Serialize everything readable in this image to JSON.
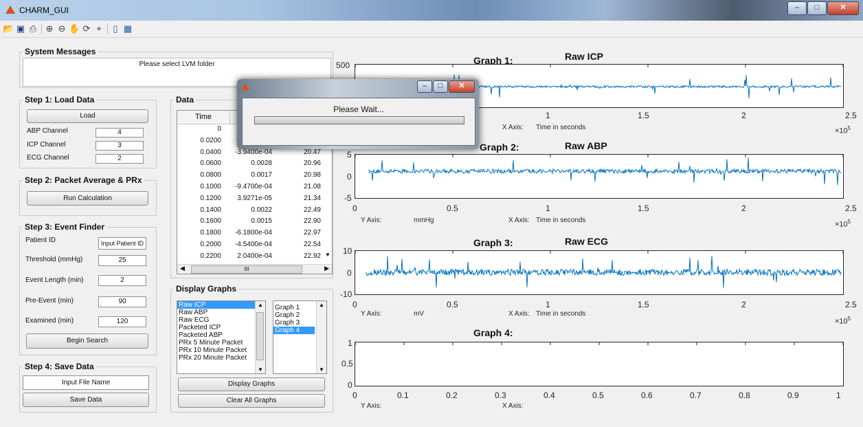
{
  "window": {
    "title": "CHARM_GUI"
  },
  "system_messages": {
    "title": "System Messages",
    "text": "Please select LVM folder"
  },
  "step1": {
    "title": "Step 1: Load Data",
    "load_button": "Load",
    "abp_label": "ABP Channel",
    "abp_value": "4",
    "icp_label": "ICP Channel",
    "icp_value": "3",
    "ecg_label": "ECG Channel",
    "ecg_value": "2"
  },
  "step2": {
    "title": "Step 2: Packet Average & PRx",
    "run_button": "Run Calculation"
  },
  "step3": {
    "title": "Step 3: Event Finder",
    "patient_id_label": "Patient ID",
    "patient_id_value": "Input Patient ID",
    "threshold_label": "Threshold (mmHg)",
    "threshold_value": "25",
    "event_length_label": "Event Length (min)",
    "event_length_value": "2",
    "pre_event_label": "Pre-Event (min)",
    "pre_event_value": "90",
    "examined_label": "Examined (min)",
    "examined_value": "120",
    "search_button": "Begin Search"
  },
  "step4": {
    "title": "Step 4: Save Data",
    "file_name": "Input File Name",
    "save_button": "Save Data"
  },
  "data_panel": {
    "title": "Data",
    "columns": [
      "Time"
    ],
    "rows": [
      [
        "0",
        "",
        ""
      ],
      [
        "0.0200",
        "",
        ""
      ],
      [
        "0.0400",
        "-3.9400e-04",
        "20.47"
      ],
      [
        "0.0600",
        "0.0028",
        "20.96"
      ],
      [
        "0.0800",
        "0.0017",
        "20.98"
      ],
      [
        "0.1000",
        "-9.4700e-04",
        "21.08"
      ],
      [
        "0.1200",
        "3.9271e-05",
        "21.34"
      ],
      [
        "0.1400",
        "0.0022",
        "22.49"
      ],
      [
        "0.1600",
        "0.0015",
        "22.90"
      ],
      [
        "0.1800",
        "-6.1800e-04",
        "22.97"
      ],
      [
        "0.2000",
        "-4.5400e-04",
        "22.54"
      ],
      [
        "0.2200",
        "2.0400e-04",
        "22.92"
      ]
    ],
    "hscroll_thumb": "III"
  },
  "display_graphs": {
    "title": "Display Graphs",
    "signals": [
      "Raw ICP",
      "Raw ABP",
      "Raw ECG",
      "Packeted ICP",
      "Packeted ABP",
      "PRx 5 Minute Packet",
      "PRx 10 Minute Packet",
      "PRx 20 Minute Packet"
    ],
    "signal_selected": "Raw ICP",
    "graphs": [
      "Graph 1",
      "Graph 2",
      "Graph 3",
      "Graph 4"
    ],
    "graph_selected": "Graph 4",
    "display_button": "Display Graphs",
    "clear_button": "Clear All Graphs"
  },
  "dialog": {
    "message": "Please Wait..."
  },
  "graphs": {
    "g1": {
      "label": "Graph 1:",
      "name": "Raw ICP",
      "y_top": "500",
      "x_ticks": [
        "1",
        "1.5",
        "2",
        "2.5"
      ],
      "x_axis_label": "X Axis:",
      "x_axis_value": "Time in seconds",
      "exp": "×10",
      "exp_pow": "5"
    },
    "g2": {
      "label": "Graph 2:",
      "name": "Raw ABP",
      "y_ticks": [
        "5",
        "0",
        "-5"
      ],
      "x_ticks": [
        "0",
        "0.5",
        "1",
        "1.5",
        "2",
        "2.5"
      ],
      "y_axis_label": "Y Axis:",
      "y_axis_value": "mmHg",
      "x_axis_label": "X Axis:",
      "x_axis_value": "Time in seconds",
      "exp": "×10",
      "exp_pow": "5"
    },
    "g3": {
      "label": "Graph 3:",
      "name": "Raw ECG",
      "y_ticks": [
        "10",
        "0",
        "-10"
      ],
      "x_ticks": [
        "0",
        "0.5",
        "1",
        "1.5",
        "2",
        "2.5"
      ],
      "y_axis_label": "Y Axis:",
      "y_axis_value": "mV",
      "x_axis_label": "X Axis:",
      "x_axis_value": "Time in seconds",
      "exp": "×10",
      "exp_pow": "5"
    },
    "g4": {
      "label": "Graph 4:",
      "y_ticks": [
        "1",
        "0.5",
        "0"
      ],
      "x_ticks": [
        "0",
        "0.1",
        "0.2",
        "0.3",
        "0.4",
        "0.5",
        "0.6",
        "0.7",
        "0.8",
        "0.9",
        "1"
      ],
      "y_axis_label": "Y Axis:",
      "x_axis_label": "X Axis:"
    }
  },
  "toolbar_icons": [
    "open-file-icon",
    "save-icon",
    "print-icon",
    "zoom-in-icon",
    "zoom-out-icon",
    "pan-icon",
    "rotate-3d-icon",
    "data-cursor-icon",
    "colorbar-icon",
    "legend-icon"
  ],
  "colors": {
    "signal": "#0072bd",
    "selection": "#3399ff",
    "close_button": "#c4402a"
  }
}
